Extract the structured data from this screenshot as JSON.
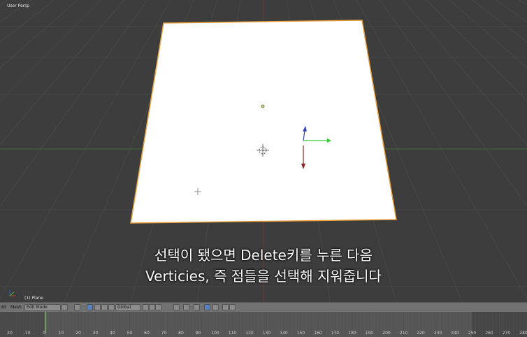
{
  "viewport": {
    "view_name": "User Persp",
    "object_label": "(1) Plane",
    "axis_x_color": "#cc3333",
    "axis_y_color": "#33cc33",
    "axis_z_color": "#3355cc"
  },
  "subtitles": {
    "line1": "선택이 됐으면 Delete키를 누른 다음",
    "line2": "Verticies, 즉 점들을 선택해 지워줍니다"
  },
  "header": {
    "menu_add": "dd",
    "menu_mesh": "Mesh",
    "mode": "Edit Mode",
    "orientation": "Global"
  },
  "timeline": {
    "frame_labels": [
      "20",
      "-10",
      "0",
      "10",
      "20",
      "30",
      "40",
      "50",
      "60",
      "70",
      "80",
      "90",
      "100",
      "110",
      "120",
      "130",
      "140",
      "150",
      "160",
      "170",
      "180",
      "190",
      "200",
      "210",
      "220",
      "230",
      "240",
      "250",
      "260",
      "270",
      "280"
    ],
    "current_frame": "1",
    "end_frame": "250"
  }
}
